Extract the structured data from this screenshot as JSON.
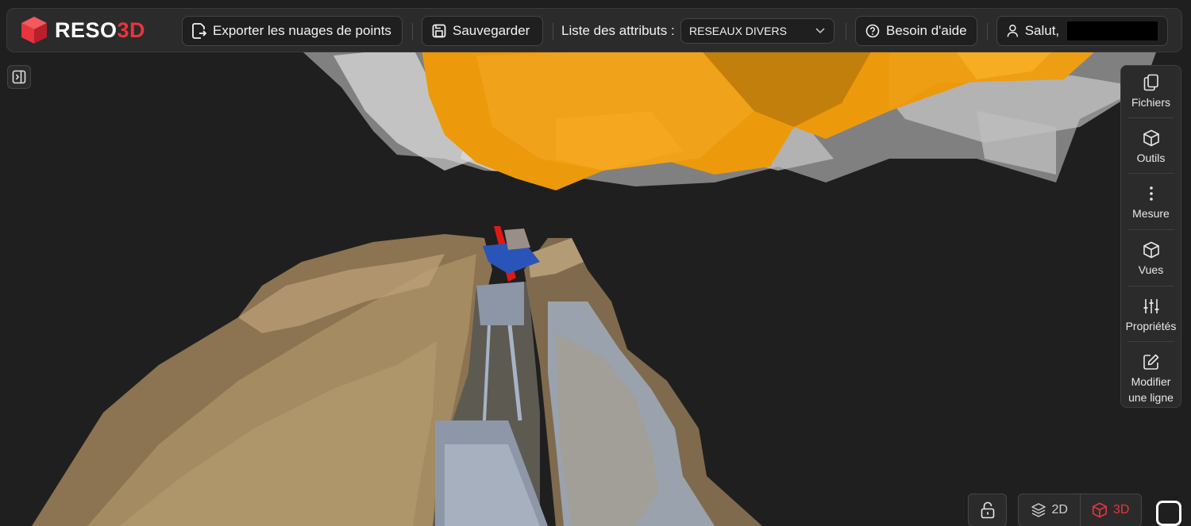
{
  "app": {
    "logo_text_main": "RESO",
    "logo_text_accent": "3D",
    "brand_color": "#e8343f"
  },
  "toolbar": {
    "export_label": "Exporter les nuages de points",
    "save_label": "Sauvegarder",
    "attr_list_label": "Liste des attributs :",
    "attr_selected": "RESEAUX DIVERS",
    "help_label": "Besoin d'aide",
    "greeting": "Salut,"
  },
  "side_tools": [
    {
      "label": "Fichiers",
      "icon": "files-icon"
    },
    {
      "label": "Outils",
      "icon": "cube-icon"
    },
    {
      "label": "Mesure",
      "icon": "dots-vertical-icon"
    },
    {
      "label": "Vues",
      "icon": "cube-icon"
    },
    {
      "label": "Propriétés",
      "icon": "sliders-icon"
    },
    {
      "label": "Modifier une ligne",
      "icon": "edit-icon"
    }
  ],
  "view_modes": {
    "mode_2d": "2D",
    "mode_3d": "3D",
    "active": "3D"
  }
}
